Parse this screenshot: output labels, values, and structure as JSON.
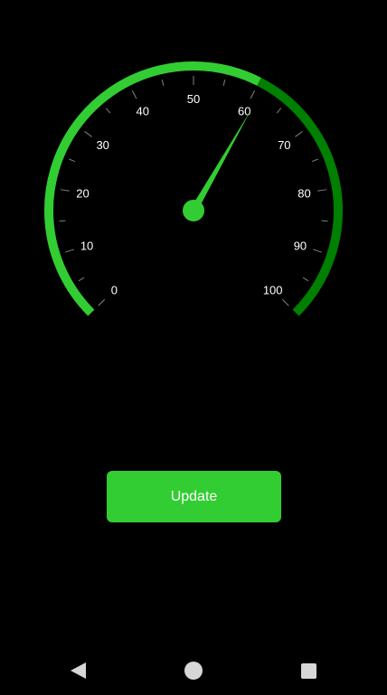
{
  "gauge": {
    "min": 0,
    "max": 100,
    "value": 61,
    "tick_labels": [
      "0",
      "10",
      "20",
      "30",
      "40",
      "50",
      "60",
      "70",
      "80",
      "90",
      "100"
    ],
    "start_angle_deg": 225,
    "end_angle_deg": -45,
    "accent_color": "#32cd32",
    "dark_range_color": "#008000",
    "dark_range_from": 60,
    "tick_color": "#808080",
    "label_color": "#ffffff",
    "needle_color": "#32cd32"
  },
  "button": {
    "label": "Update",
    "color": "#32cd32"
  },
  "nav": {
    "back_icon": "back-triangle-icon",
    "home_icon": "home-circle-icon",
    "recents_icon": "recents-square-icon",
    "icon_color": "#d7d7d7"
  }
}
